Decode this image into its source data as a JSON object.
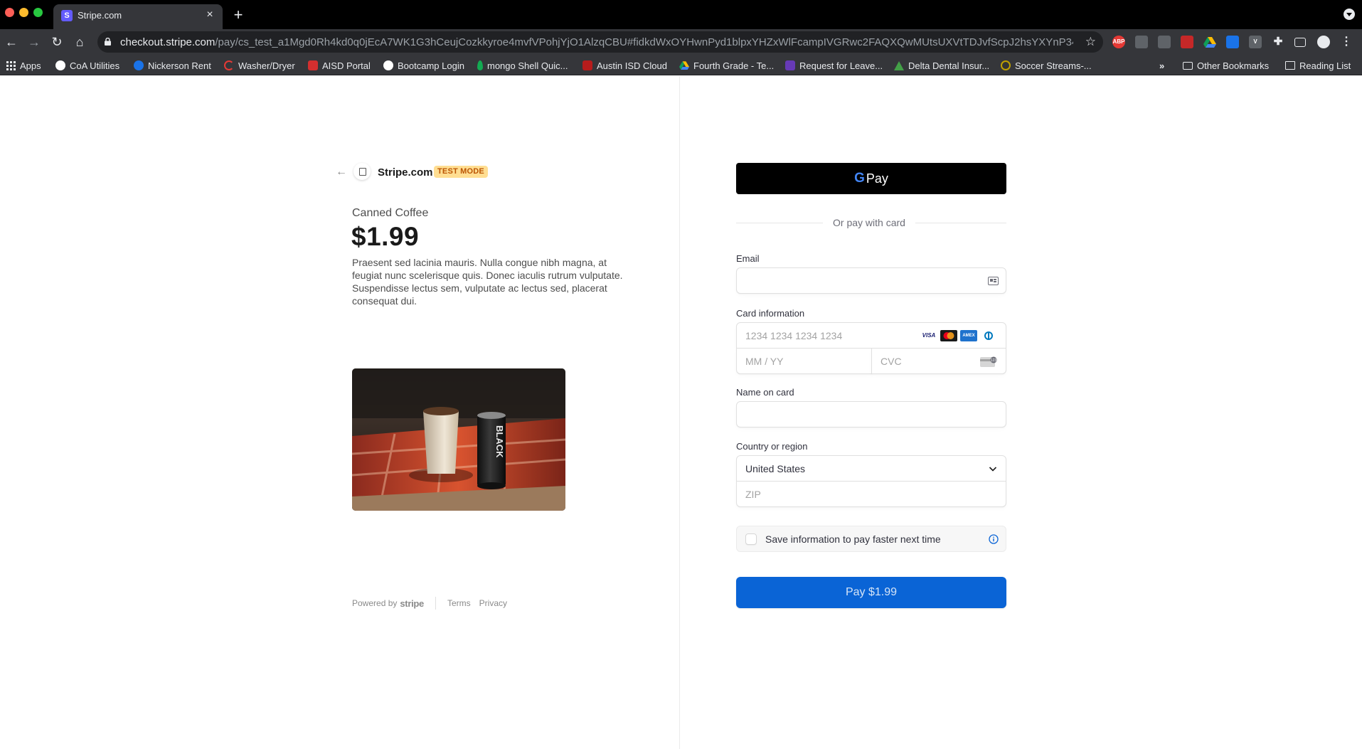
{
  "browser": {
    "tab_title": "Stripe.com",
    "tab_favicon": "S",
    "url_host": "checkout.stripe.com",
    "url_path": "/pay/cs_test_a1Mgd0Rh4kd0q0jEcA7WK1G3hCeujCozkkyroe4mvfVPohjYjO1AlzqCBU#fidkdWxOYHwnPyd1blpxYHZxWlFcampIVGRwc2FAQXQwMUtsUXVtTDJvfScpJ2hsYXYnP34nYn...",
    "bookmarks": [
      {
        "label": "Apps",
        "icon": "apps-grid-icon"
      },
      {
        "label": "CoA Utilities",
        "icon": "coa-icon"
      },
      {
        "label": "Nickerson Rent",
        "icon": "nickerson-icon"
      },
      {
        "label": "Washer/Dryer",
        "icon": "washer-icon"
      },
      {
        "label": "AISD Portal",
        "icon": "aisd-icon"
      },
      {
        "label": "Bootcamp Login",
        "icon": "bootcamp-icon"
      },
      {
        "label": "mongo Shell Quic...",
        "icon": "mongo-leaf-icon"
      },
      {
        "label": "Austin ISD Cloud",
        "icon": "austin-isd-icon"
      },
      {
        "label": "Fourth Grade - Te...",
        "icon": "google-drive-icon"
      },
      {
        "label": "Request for Leave...",
        "icon": "form-icon"
      },
      {
        "label": "Delta Dental Insur...",
        "icon": "delta-dental-icon"
      },
      {
        "label": "Soccer Streams-...",
        "icon": "soccer-icon"
      }
    ],
    "other_bookmarks": "Other Bookmarks",
    "reading_list": "Reading List"
  },
  "merchant": {
    "name": "Stripe.com",
    "badge": "TEST MODE"
  },
  "product": {
    "name": "Canned Coffee",
    "price": "$1.99",
    "description": "Praesent sed lacinia mauris. Nulla congue nibh magna, at feugiat nunc scelerisque quis. Donec iaculis rutrum vulputate. Suspendisse lectus sem, vulputate ac lectus sed, placerat consequat dui.",
    "image_can_text": "BLACK"
  },
  "footer": {
    "powered_by": "Powered by",
    "brand": "stripe",
    "terms": "Terms",
    "privacy": "Privacy"
  },
  "payment": {
    "gpay_g": "G",
    "gpay_label": "Pay",
    "divider_text": "Or pay with card",
    "email_label": "Email",
    "email_value": "",
    "card_label": "Card information",
    "card_number_placeholder": "1234 1234 1234 1234",
    "card_brands": [
      "VISA",
      "mastercard",
      "AMEX",
      "diners"
    ],
    "expiry_placeholder": "MM / YY",
    "cvc_placeholder": "CVC",
    "name_label": "Name on card",
    "name_value": "",
    "country_label": "Country or region",
    "country_value": "United States",
    "zip_placeholder": "ZIP",
    "save_info_label": "Save information to pay faster next time",
    "save_info_checked": false,
    "pay_button": "Pay $1.99"
  },
  "colors": {
    "pay_button": "#0a64d6",
    "test_badge_bg": "#ffde92",
    "test_badge_text": "#bb5504"
  }
}
